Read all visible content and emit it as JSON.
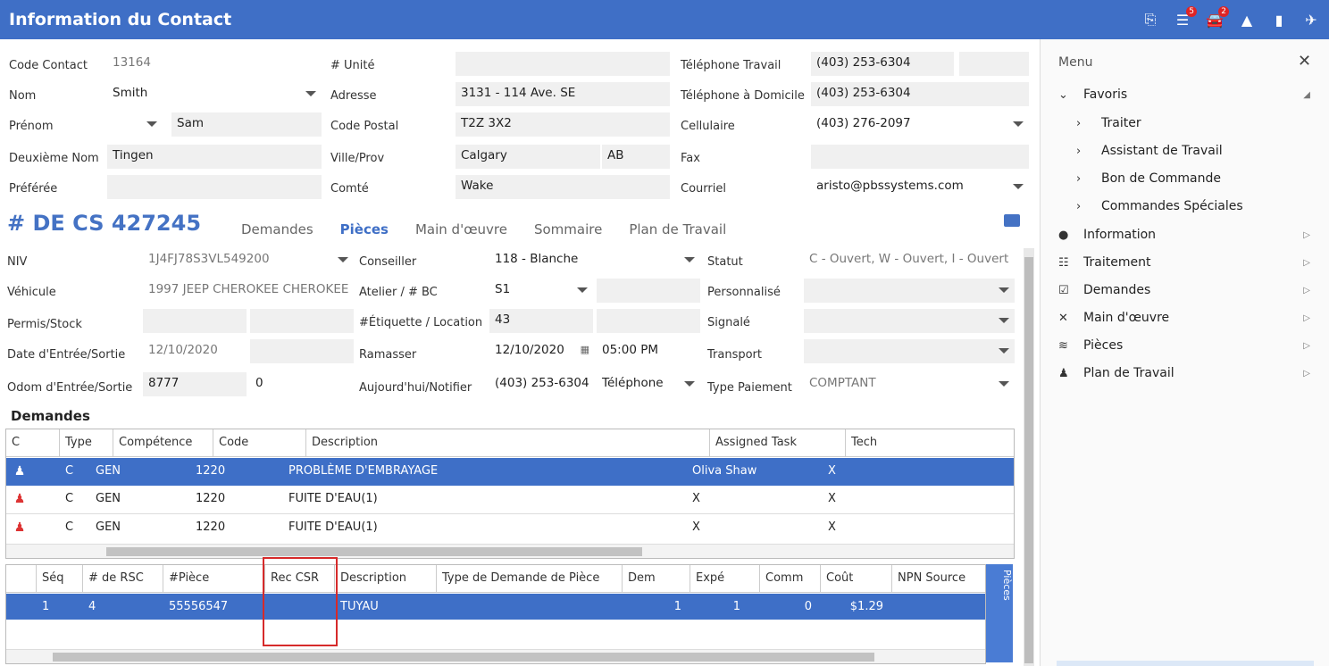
{
  "window": {
    "title": "Information du Contact",
    "badge_tasks": "5",
    "badge_cars": "2"
  },
  "contact": {
    "code_label": "Code Contact",
    "code": "13164",
    "nom_label": "Nom",
    "nom": "Smith",
    "prenom_label": "Prénom",
    "prenom": "Sam",
    "deuxieme_label": "Deuxième Nom",
    "deuxieme": "Tingen",
    "preferee_label": "Préférée",
    "preferee": "",
    "unite_label": "# Unité",
    "unite": "",
    "adresse_label": "Adresse",
    "adresse": "3131 - 114 Ave. SE",
    "postal_label": "Code Postal",
    "postal": "T2Z 3X2",
    "ville_label": "Ville/Prov",
    "ville": "Calgary",
    "prov": "AB",
    "comte_label": "Comté",
    "comte": "Wake",
    "tel_travail_label": "Téléphone Travail",
    "tel_travail": "(403) 253-6304",
    "tel_domicile_label": "Téléphone à Domicile",
    "tel_domicile": "(403) 253-6304",
    "cell_label": "Cellulaire",
    "cell": "(403) 276-2097",
    "fax_label": "Fax",
    "fax": "",
    "courriel_label": "Courriel",
    "courriel": "aristo@pbssystems.com"
  },
  "order": {
    "number": "# DE CS 427245",
    "tabs": [
      "Demandes",
      "Pièces",
      "Main d'œuvre",
      "Sommaire",
      "Plan de Travail"
    ],
    "niv_label": "NIV",
    "niv": "1J4FJ78S3VL549200",
    "vehicule_label": "Véhicule",
    "vehicule": "1997 JEEP CHEROKEE CHEROKEE",
    "permis_label": "Permis/Stock",
    "date_label": "Date d'Entrée/Sortie",
    "date": "12/10/2020",
    "odom_label": "Odom d'Entrée/Sortie",
    "odom_in": "8777",
    "odom_out": "0",
    "conseiller_label": "Conseiller",
    "conseiller": "118 - Blanche",
    "atelier_label": "Atelier / # BC",
    "atelier": "S1",
    "etiquette_label": "#Étiquette / Location",
    "etiquette": "43",
    "ramasser_label": "Ramasser",
    "ramasser_date": "12/10/2020",
    "ramasser_time": "05:00 PM",
    "notifier_label": "Aujourd'hui/Notifier",
    "notifier": "(403) 253-6304",
    "notifier_type": "Téléphone",
    "statut_label": "Statut",
    "statut": "C - Ouvert, W - Ouvert, I - Ouvert",
    "perso_label": "Personnalisé",
    "signale_label": "Signalé",
    "transport_label": "Transport",
    "paiement_label": "Type Paiement",
    "paiement": "COMPTANT"
  },
  "demandes": {
    "title": "Demandes",
    "headers": [
      "C",
      "Type",
      "Compétence",
      "Code",
      "Description",
      "Assigned Task",
      "Tech"
    ],
    "rows": [
      [
        "C",
        "GEN",
        "1220",
        "PROBLÈME D'EMBRAYAGE",
        "Oliva Shaw",
        "X"
      ],
      [
        "C",
        "GEN",
        "1220",
        "FUITE D'EAU(1)",
        "X",
        "X"
      ],
      [
        "C",
        "GEN",
        "1220",
        "FUITE D'EAU(1)",
        "X",
        "X"
      ]
    ]
  },
  "pieces": {
    "headers": [
      "Séq",
      "# de RSC",
      "#Pièce",
      "Rec CSR",
      "Description",
      "Type de Demande de Pièce",
      "Dem",
      "Expé",
      "Comm",
      "Coût",
      "NPN Source"
    ],
    "row": [
      "1",
      "4",
      "55556547",
      "",
      "TUYAU",
      "",
      "1",
      "1",
      "0",
      "$1.29",
      ""
    ],
    "side_tab": "Pièces"
  },
  "sidebar": {
    "title": "Menu",
    "favoris": "Favoris",
    "favoris_items": [
      "Traiter",
      "Assistant de Travail",
      "Bon de Commande",
      "Commandes Spéciales"
    ],
    "items": [
      "Information",
      "Traitement",
      "Demandes",
      "Main d'œuvre",
      "Pièces",
      "Plan de Travail"
    ]
  }
}
